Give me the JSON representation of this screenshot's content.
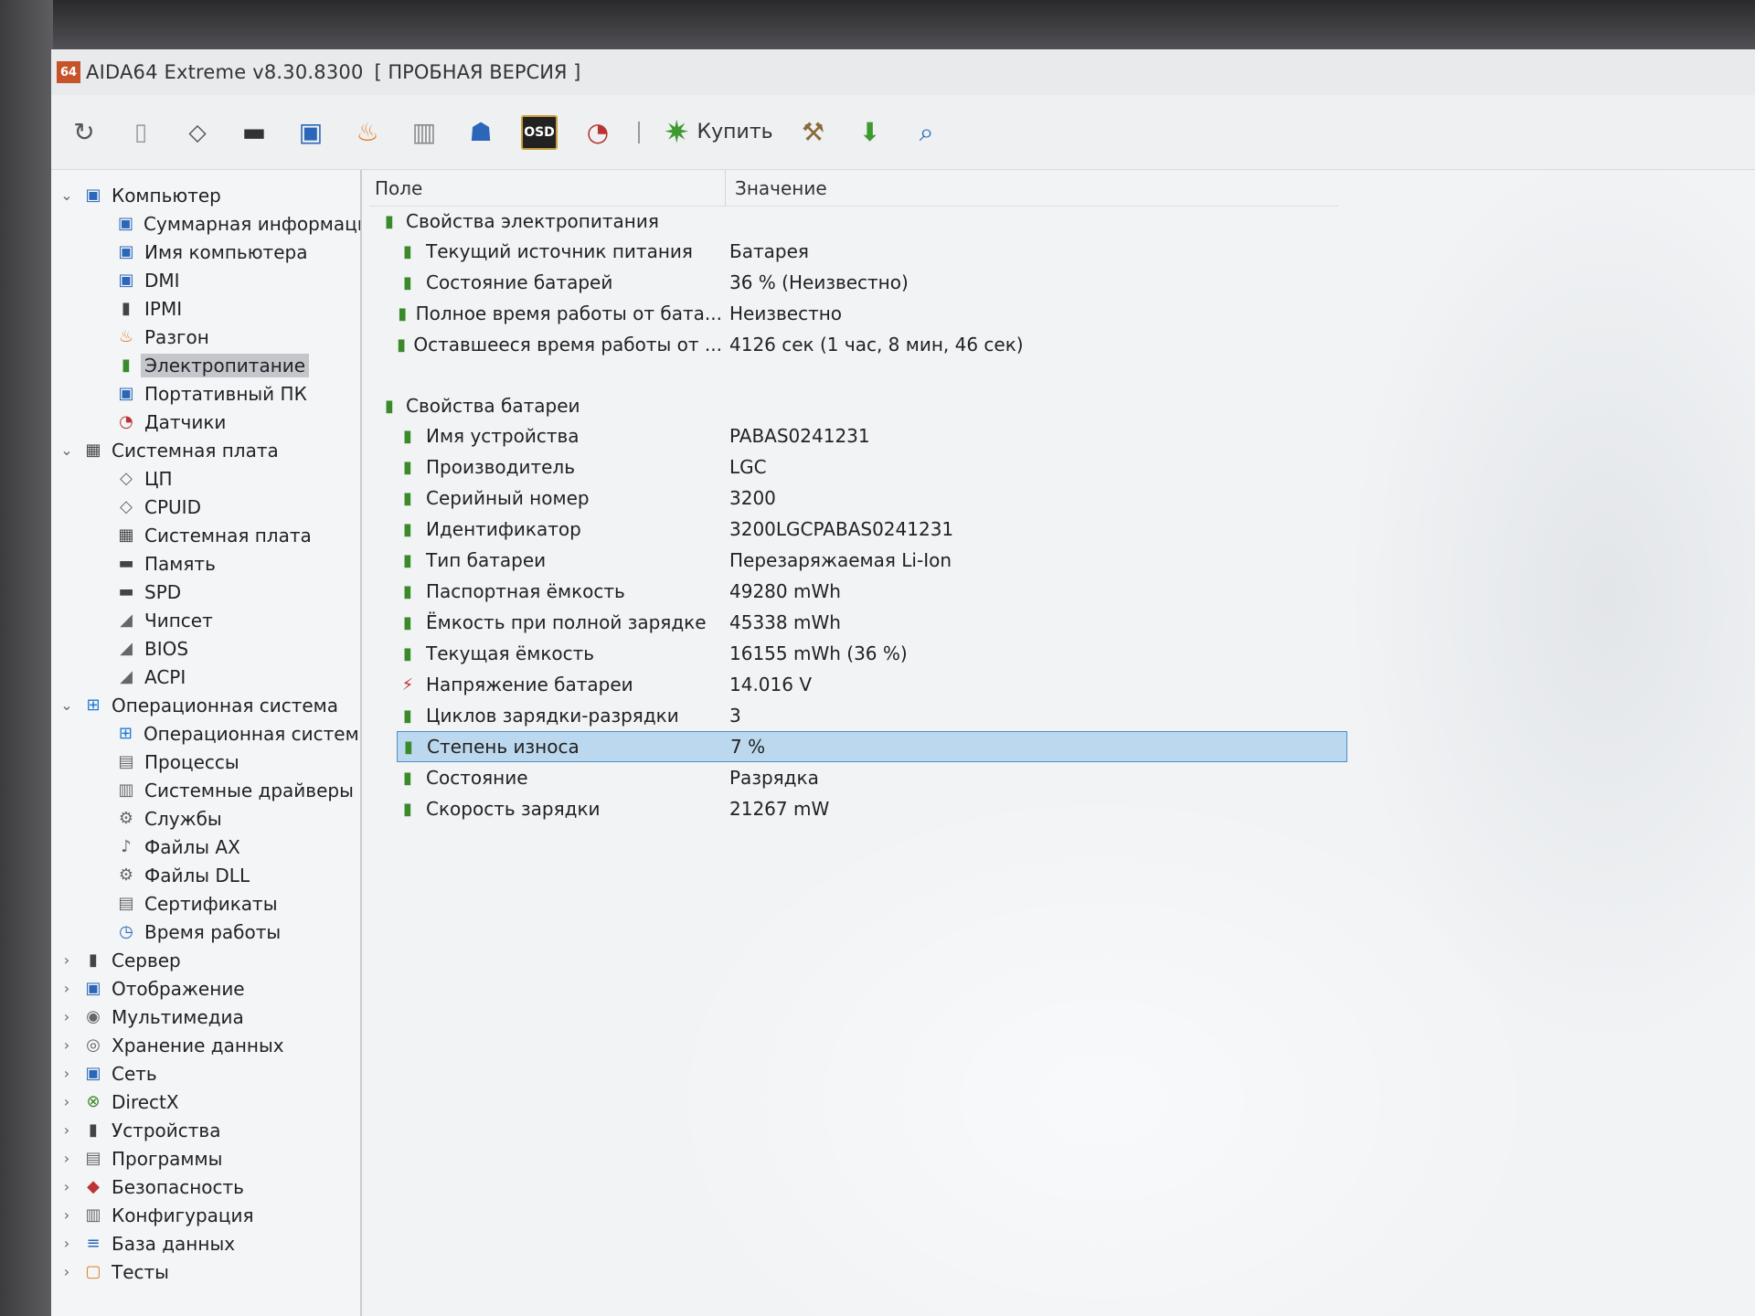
{
  "window": {
    "app_badge": "64",
    "title": "AIDA64 Extreme v8.30.8300",
    "trial_label": "[ ПРОБНАЯ ВЕРСИЯ ]"
  },
  "toolbar": {
    "buy_label": "Купить",
    "osd_label": "OSD",
    "icons": [
      "refresh-icon",
      "report-icon",
      "motherboard-icon",
      "memory-icon",
      "network-icon",
      "flame-icon",
      "benchmark-icon",
      "user-icon",
      "osd-icon",
      "gauge-icon",
      "buy-icon",
      "tools-icon",
      "download-icon",
      "search-icon"
    ]
  },
  "tree": {
    "items": [
      {
        "label": "Компьютер",
        "level": 0,
        "expander": "⌄",
        "icon": "▣"
      },
      {
        "label": "Суммарная информаци",
        "level": 1,
        "icon": "▣"
      },
      {
        "label": "Имя компьютера",
        "level": 1,
        "icon": "▣"
      },
      {
        "label": "DMI",
        "level": 1,
        "icon": "▣"
      },
      {
        "label": "IPMI",
        "level": 1,
        "icon": "▮"
      },
      {
        "label": "Разгон",
        "level": 1,
        "icon": "♨"
      },
      {
        "label": "Электропитание",
        "level": 1,
        "icon": "▮"
      },
      {
        "label": "Портативный ПК",
        "level": 1,
        "icon": "▣"
      },
      {
        "label": "Датчики",
        "level": 1,
        "icon": "◔"
      },
      {
        "label": "Системная плата",
        "level": 0,
        "expander": "⌄",
        "icon": "▦"
      },
      {
        "label": "ЦП",
        "level": 1,
        "icon": "◇"
      },
      {
        "label": "CPUID",
        "level": 1,
        "icon": "◇"
      },
      {
        "label": "Системная плата",
        "level": 1,
        "icon": "▦"
      },
      {
        "label": "Память",
        "level": 1,
        "icon": "▬"
      },
      {
        "label": "SPD",
        "level": 1,
        "icon": "▬"
      },
      {
        "label": "Чипсет",
        "level": 1,
        "icon": "◢"
      },
      {
        "label": "BIOS",
        "level": 1,
        "icon": "◢"
      },
      {
        "label": "ACPI",
        "level": 1,
        "icon": "◢"
      },
      {
        "label": "Операционная система",
        "level": 0,
        "expander": "⌄",
        "icon": "⊞"
      },
      {
        "label": "Операционная система",
        "level": 1,
        "icon": "⊞"
      },
      {
        "label": "Процессы",
        "level": 1,
        "icon": "▤"
      },
      {
        "label": "Системные драйверы",
        "level": 1,
        "icon": "▥"
      },
      {
        "label": "Службы",
        "level": 1,
        "icon": "⚙"
      },
      {
        "label": "Файлы AX",
        "level": 1,
        "icon": "♪"
      },
      {
        "label": "Файлы DLL",
        "level": 1,
        "icon": "⚙"
      },
      {
        "label": "Сертификаты",
        "level": 1,
        "icon": "▤"
      },
      {
        "label": "Время работы",
        "level": 1,
        "icon": "◷"
      },
      {
        "label": "Сервер",
        "level": 0,
        "expander": "›",
        "icon": "▮"
      },
      {
        "label": "Отображение",
        "level": 0,
        "expander": "›",
        "icon": "▣"
      },
      {
        "label": "Мультимедиа",
        "level": 0,
        "expander": "›",
        "icon": "◉"
      },
      {
        "label": "Хранение данных",
        "level": 0,
        "expander": "›",
        "icon": "◎"
      },
      {
        "label": "Сеть",
        "level": 0,
        "expander": "›",
        "icon": "▣"
      },
      {
        "label": "DirectX",
        "level": 0,
        "expander": "›",
        "icon": "⊗"
      },
      {
        "label": "Устройства",
        "level": 0,
        "expander": "›",
        "icon": "▮"
      },
      {
        "label": "Программы",
        "level": 0,
        "expander": "›",
        "icon": "▤"
      },
      {
        "label": "Безопасность",
        "level": 0,
        "expander": "›",
        "icon": "◆"
      },
      {
        "label": "Конфигурация",
        "level": 0,
        "expander": "›",
        "icon": "▥"
      },
      {
        "label": "База данных",
        "level": 0,
        "expander": "›",
        "icon": "≡"
      },
      {
        "label": "Тесты",
        "level": 0,
        "expander": "›",
        "icon": "▢"
      }
    ],
    "selected_index": 6
  },
  "grid": {
    "col_field": "Поле",
    "col_value": "Значение",
    "power_section": "Свойства электропитания",
    "power_rows": [
      {
        "field": "Текущий источник питания",
        "value": "Батарея"
      },
      {
        "field": "Состояние батарей",
        "value": "36 % (Неизвестно)"
      },
      {
        "field": "Полное время работы от бата...",
        "value": "Неизвестно"
      },
      {
        "field": "Оставшееся время работы от ...",
        "value": "4126 сек (1 час, 8 мин, 46 сек)"
      }
    ],
    "battery_section": "Свойства батареи",
    "battery_rows": [
      {
        "field": "Имя устройства",
        "value": "PABAS0241231"
      },
      {
        "field": "Производитель",
        "value": "LGC"
      },
      {
        "field": "Серийный номер",
        "value": "3200"
      },
      {
        "field": "Идентификатор",
        "value": "3200LGCPABAS0241231"
      },
      {
        "field": "Тип батареи",
        "value": "Перезаряжаемая Li-Ion"
      },
      {
        "field": "Паспортная ёмкость",
        "value": "49280 mWh"
      },
      {
        "field": "Ёмкость при полной зарядке",
        "value": "45338 mWh"
      },
      {
        "field": "Текущая ёмкость",
        "value": "16155 mWh  (36 %)"
      },
      {
        "field": "Напряжение батареи",
        "value": "14.016 V"
      },
      {
        "field": "Циклов зарядки-разрядки",
        "value": "3"
      },
      {
        "field": "Степень износа",
        "value": "7 %"
      },
      {
        "field": "Состояние",
        "value": "Разрядка"
      },
      {
        "field": "Скорость зарядки",
        "value": "21267 mW"
      }
    ],
    "battery_selected_index": 10
  }
}
